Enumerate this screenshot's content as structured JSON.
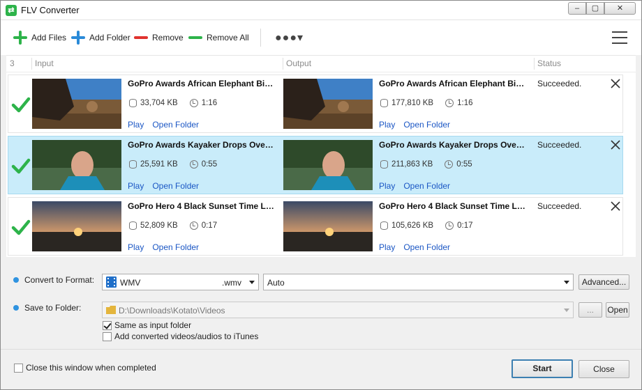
{
  "window": {
    "title": "FLV Converter"
  },
  "toolbar": {
    "add_files": "Add Files",
    "add_folder": "Add Folder",
    "remove": "Remove",
    "remove_all": "Remove All",
    "more": "●●●▾"
  },
  "list": {
    "count": "3",
    "headers": {
      "input": "Input",
      "output": "Output",
      "status": "Status"
    },
    "links": {
      "play": "Play",
      "open_folder": "Open Folder"
    },
    "rows": [
      {
        "input_name": "GoPro Awards  African Elephant Bite...",
        "input_size": "33,704 KB",
        "input_duration": "1:16",
        "output_name": "GoPro Awards  African Elephant Bite...",
        "output_size": "177,810 KB",
        "output_duration": "1:16",
        "status": "Succeeded.",
        "selected": false
      },
      {
        "input_name": "GoPro Awards  Kayaker Drops Over ...",
        "input_size": "25,591 KB",
        "input_duration": "0:55",
        "output_name": "GoPro Awards  Kayaker Drops Over ...",
        "output_size": "211,863 KB",
        "output_duration": "0:55",
        "status": "Succeeded.",
        "selected": true
      },
      {
        "input_name": "GoPro Hero 4  Black Sunset Time Lap...",
        "input_size": "52,809 KB",
        "input_duration": "0:17",
        "output_name": "GoPro Hero 4  Black Sunset Time Lap...",
        "output_size": "105,626 KB",
        "output_duration": "0:17",
        "status": "Succeeded.",
        "selected": false
      }
    ]
  },
  "settings": {
    "format_label": "Convert to Format:",
    "format_value": "WMV",
    "format_ext": ".wmv",
    "quality_value": "Auto",
    "advanced_button": "Advanced...",
    "folder_label": "Save to Folder:",
    "folder_value": "D:\\Downloads\\Kotato\\Videos",
    "browse_button": "...",
    "open_button": "Open",
    "same_as_input": "Same as input folder",
    "same_as_input_checked": true,
    "add_to_itunes": "Add converted videos/audios to iTunes",
    "add_to_itunes_checked": false
  },
  "footer": {
    "close_when_completed": "Close this window when completed",
    "close_when_completed_checked": false,
    "start_button": "Start",
    "close_button": "Close"
  },
  "colors": {
    "accent_green": "#2db34a",
    "add_blue": "#2a8ad8",
    "remove_red": "#e0322e",
    "link_blue": "#1a56c4",
    "selected_row": "#c9ecfa"
  }
}
